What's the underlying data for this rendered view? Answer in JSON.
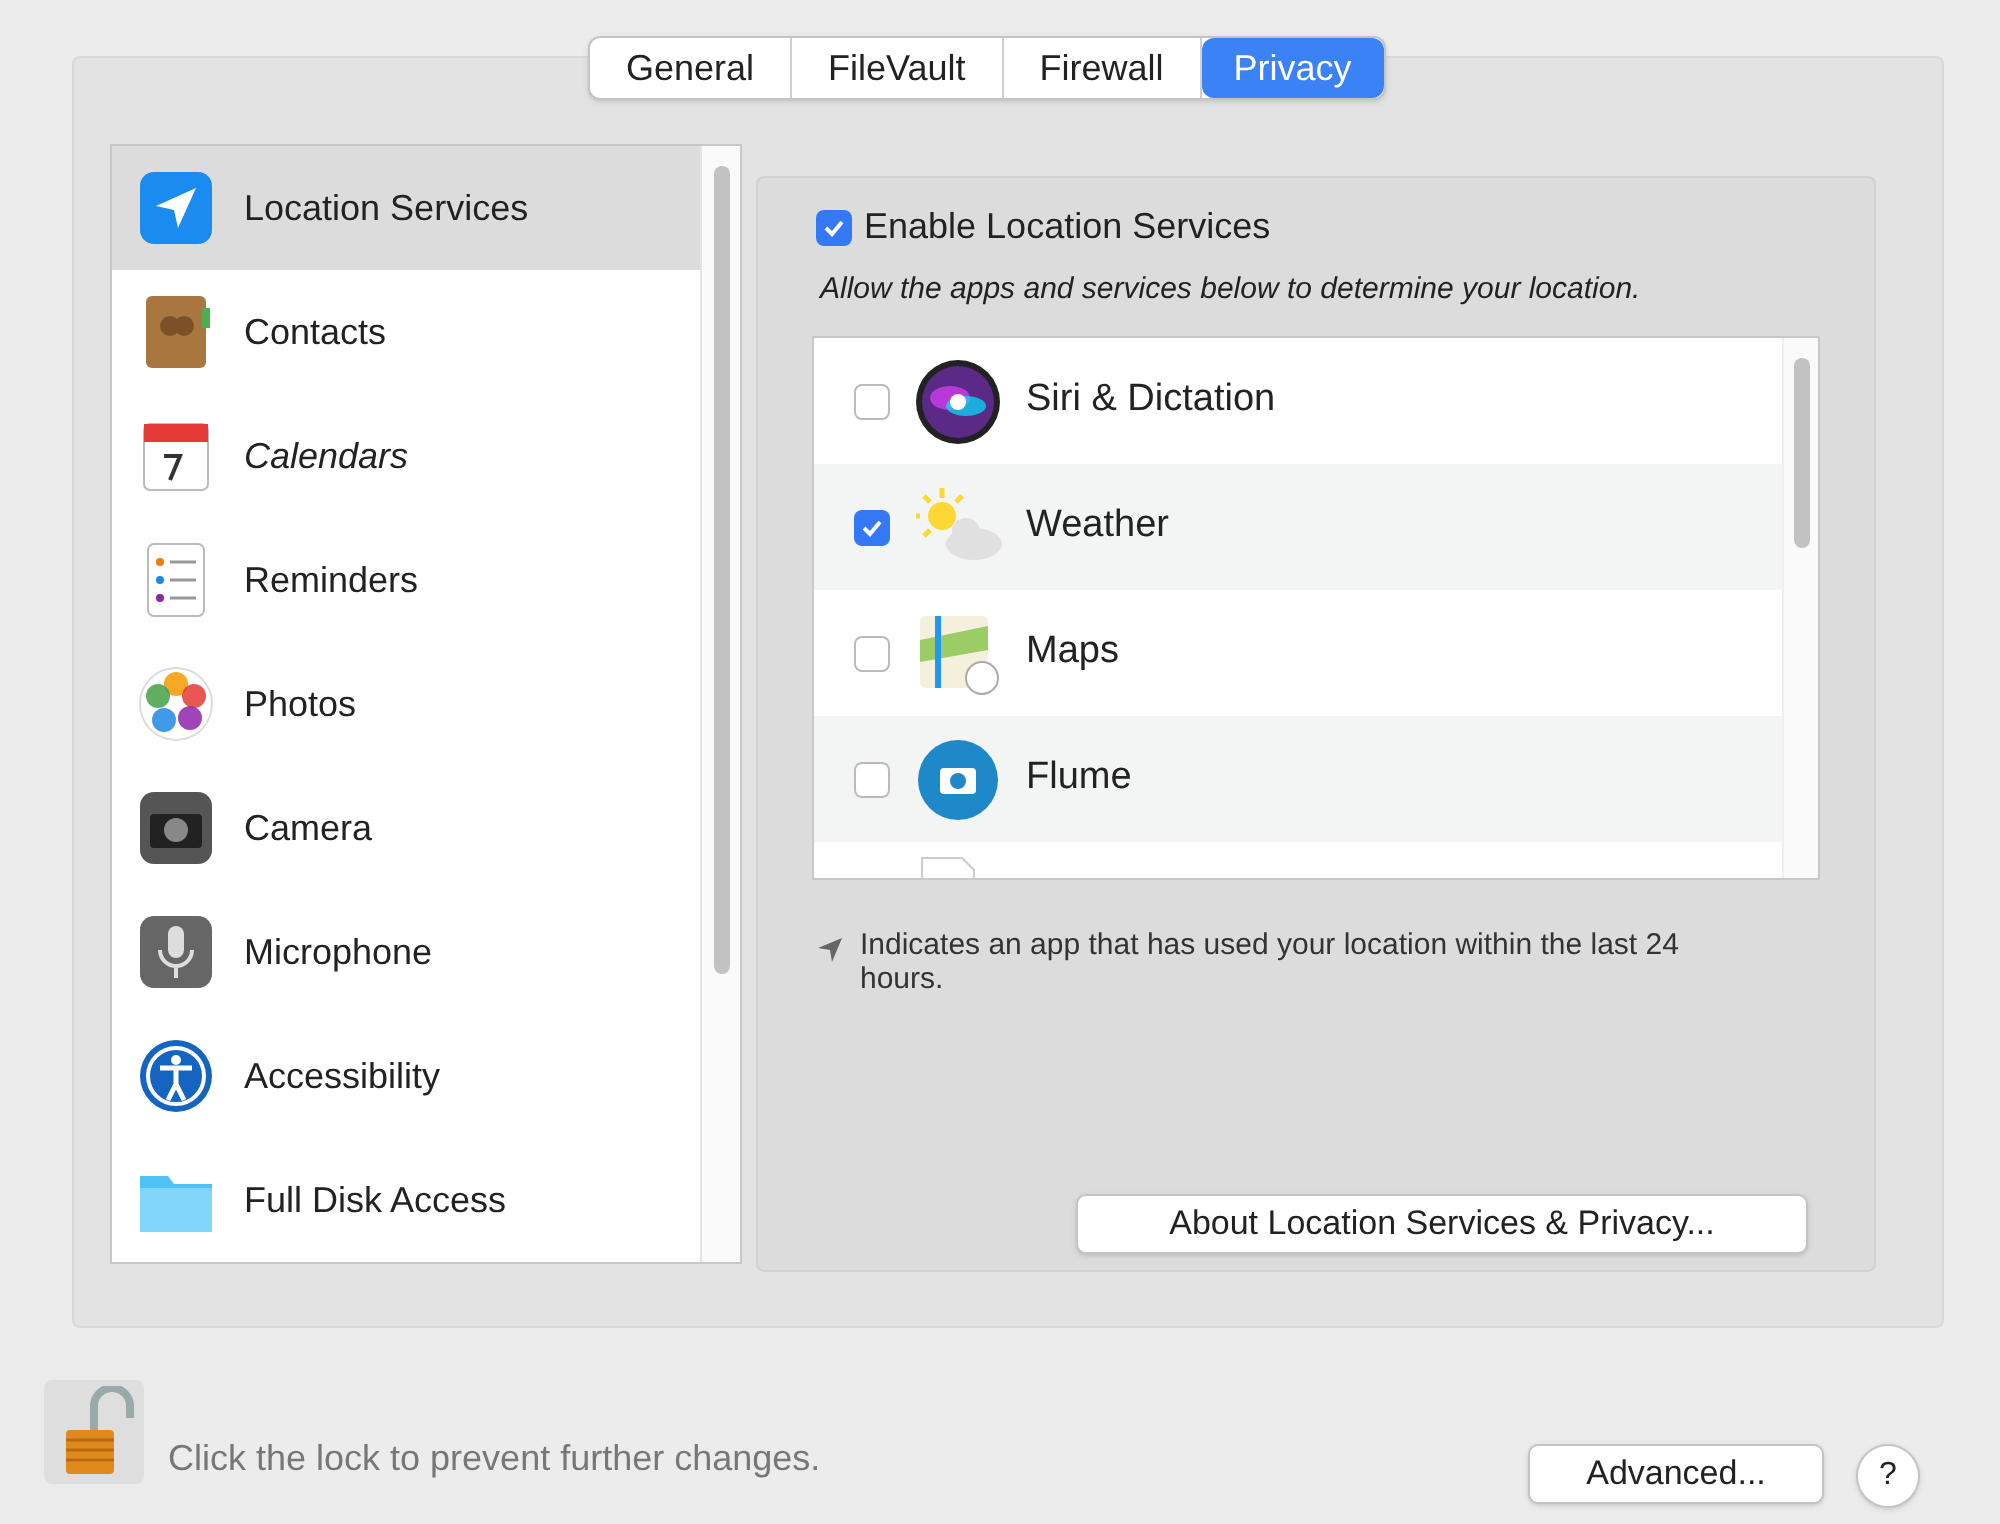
{
  "tabs": [
    {
      "label": "General",
      "selected": false
    },
    {
      "label": "FileVault",
      "selected": false
    },
    {
      "label": "Firewall",
      "selected": false
    },
    {
      "label": "Privacy",
      "selected": true
    }
  ],
  "sidebar": {
    "items": [
      {
        "label": "Location Services",
        "selected": true
      },
      {
        "label": "Contacts",
        "selected": false
      },
      {
        "label": "Calendars",
        "selected": false
      },
      {
        "label": "Reminders",
        "selected": false
      },
      {
        "label": "Photos",
        "selected": false
      },
      {
        "label": "Camera",
        "selected": false
      },
      {
        "label": "Microphone",
        "selected": false
      },
      {
        "label": "Accessibility",
        "selected": false
      },
      {
        "label": "Full Disk Access",
        "selected": false
      }
    ]
  },
  "location": {
    "enable": {
      "label": "Enable Location Services",
      "checked": true
    },
    "description": "Allow the apps and services below to determine your location.",
    "apps": [
      {
        "name": "Siri & Dictation",
        "checked": false
      },
      {
        "name": "Weather",
        "checked": true
      },
      {
        "name": "Maps",
        "checked": false
      },
      {
        "name": "Flume",
        "checked": false
      }
    ],
    "note": "Indicates an app that has used your location within the last 24 hours.",
    "about_button": "About Location Services & Privacy..."
  },
  "footer": {
    "lock_text": "Click the lock to prevent further changes.",
    "advanced_button": "Advanced...",
    "help_button": "?"
  }
}
